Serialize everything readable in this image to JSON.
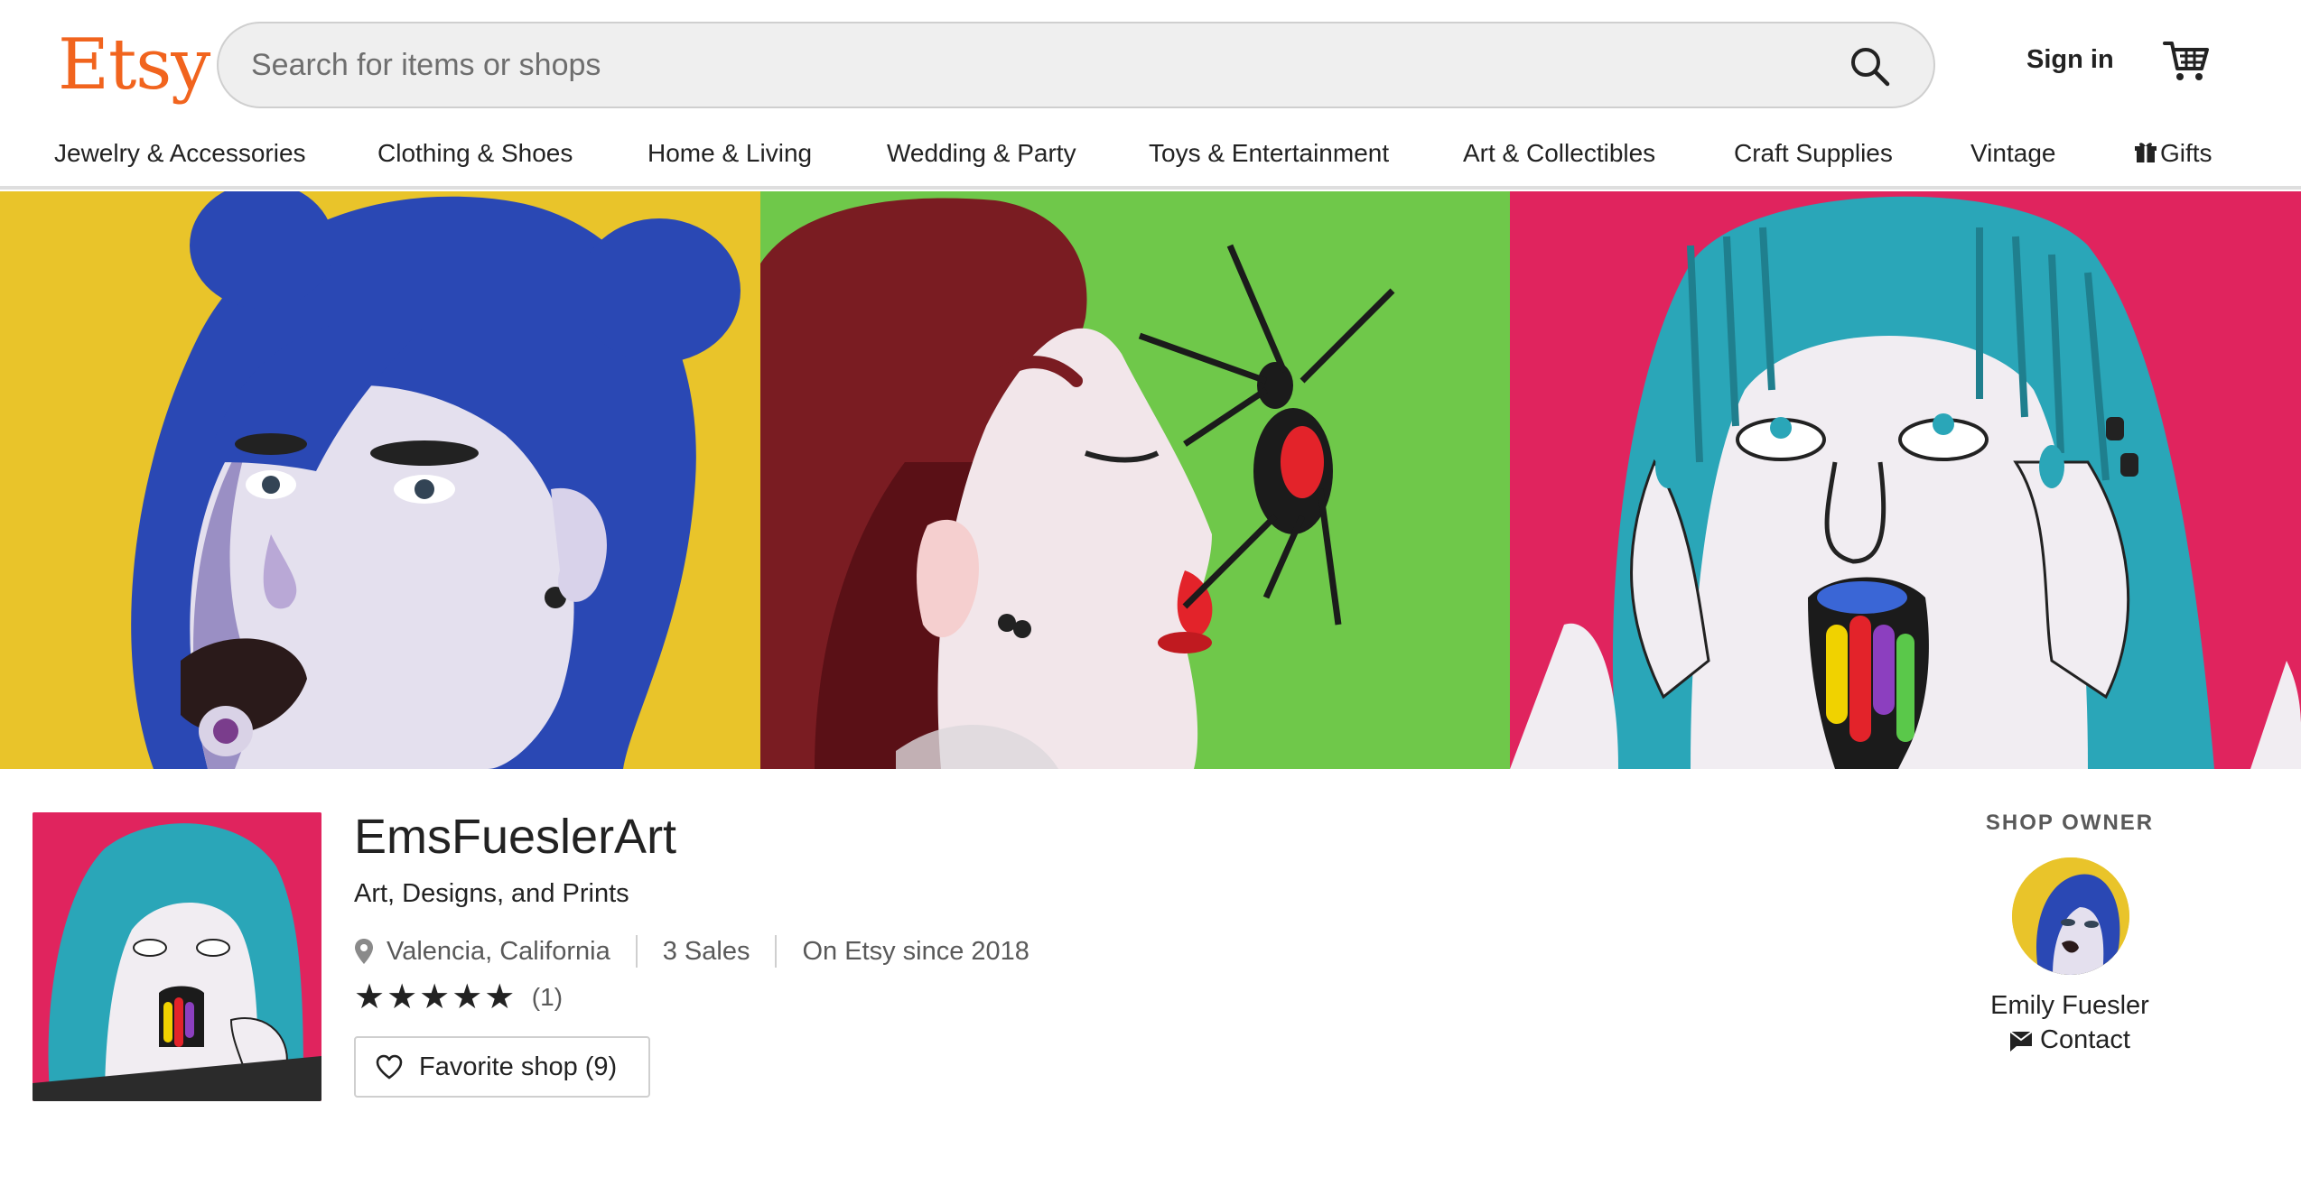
{
  "header": {
    "logo": "Etsy",
    "search_placeholder": "Search for items or shops",
    "sign_in": "Sign in"
  },
  "categories": [
    {
      "label": "Jewelry & Accessories"
    },
    {
      "label": "Clothing & Shoes"
    },
    {
      "label": "Home & Living"
    },
    {
      "label": "Wedding & Party"
    },
    {
      "label": "Toys & Entertainment"
    },
    {
      "label": "Art & Collectibles"
    },
    {
      "label": "Craft Supplies"
    },
    {
      "label": "Vintage"
    },
    {
      "label": "Gifts"
    }
  ],
  "shop": {
    "name": "EmsFueslerArt",
    "tagline": "Art, Designs, and Prints",
    "location": "Valencia, California",
    "sales": "3 Sales",
    "since": "On Etsy since 2018",
    "stars": "★★★★★",
    "rating_count": "(1)",
    "favorite_label": "Favorite shop (9)"
  },
  "owner": {
    "title": "SHOP OWNER",
    "name": "Emily Fuesler",
    "contact": "Contact"
  },
  "colors": {
    "brand": "#F1641E",
    "panel_yellow": "#e9c42a",
    "panel_green": "#6fc84a",
    "panel_pink": "#e0245e"
  }
}
